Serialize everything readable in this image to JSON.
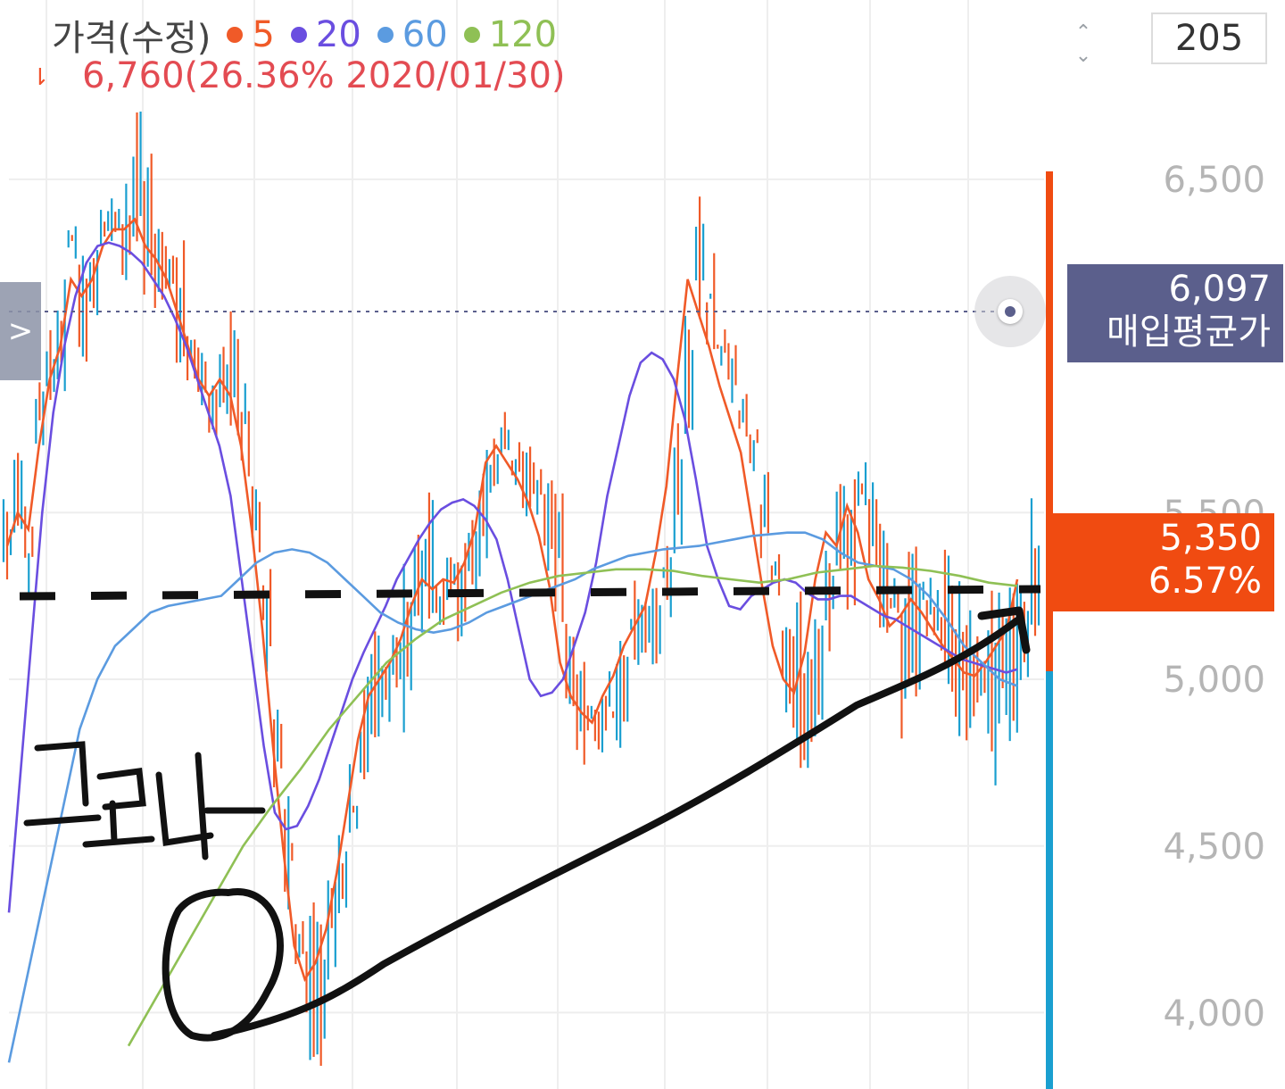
{
  "legend": {
    "title": "가격(수정)",
    "items": [
      {
        "label": "5",
        "color": "#f05a28"
      },
      {
        "label": "20",
        "color": "#6a4ee0"
      },
      {
        "label": "60",
        "color": "#5b9be0"
      },
      {
        "label": "120",
        "color": "#8fc055"
      }
    ]
  },
  "high_info": "6,760(26.36% 2020/01/30)",
  "high_marker": "⇂",
  "stepper": {
    "up": "⌃",
    "down": "⌄"
  },
  "candle_count": "205",
  "side_tab_icon": ">",
  "avg_price": {
    "value": "6,097",
    "label": "매입평균가",
    "color": "#5b5f8c"
  },
  "current_price": {
    "value": "5,350",
    "change": "6.57%",
    "color": "#f04b11"
  },
  "colors": {
    "up": "#f05a28",
    "down": "#1a9fd0",
    "grid": "#eeeeee"
  },
  "chart_data": {
    "type": "line",
    "y_ticks": [
      "6,500",
      "5,500",
      "5,000",
      "4,500",
      "4,000"
    ],
    "y_tick_values": [
      6500,
      5500,
      5000,
      4500,
      4000
    ],
    "ylim": [
      3850,
      6800
    ],
    "grid": true,
    "candles": [
      5400,
      5620,
      5350,
      5800,
      5950,
      6000,
      6300,
      6150,
      6200,
      6350,
      6400,
      6380,
      6450,
      6300,
      6250,
      6200,
      6100,
      6000,
      5900,
      5800,
      5950,
      5900,
      5750,
      5500,
      5200,
      4800,
      4500,
      4200,
      4050,
      4100,
      4250,
      4400,
      4600,
      4800,
      4950,
      5000,
      5050,
      5100,
      5200,
      5300,
      5250,
      5300,
      5280,
      5350,
      5450,
      5650,
      5700,
      5650,
      5600,
      5550,
      5450,
      5300,
      5050,
      4950,
      4900,
      4850,
      4950,
      5000,
      5100,
      5150,
      5200,
      5350,
      5550,
      5900,
      6250,
      6100,
      6000,
      5900,
      5800,
      5700,
      5500,
      5300,
      5100,
      5000,
      4950,
      5050,
      5300,
      5450,
      5400,
      5550,
      5450,
      5300,
      5250,
      5150,
      5200,
      5250,
      5200,
      5150,
      5100,
      5050,
      5000,
      5000,
      5050,
      5100,
      5150,
      5350
    ],
    "series": [
      {
        "name": "5",
        "color": "#f05a28",
        "values": [
          5400,
          5500,
          5450,
          5700,
          5900,
          6000,
          6200,
          6150,
          6200,
          6300,
          6350,
          6350,
          6380,
          6300,
          6260,
          6200,
          6100,
          6000,
          5900,
          5850,
          5900,
          5850,
          5700,
          5450,
          5150,
          4800,
          4480,
          4200,
          4100,
          4150,
          4250,
          4420,
          4620,
          4820,
          4950,
          5000,
          5050,
          5120,
          5220,
          5300,
          5270,
          5300,
          5290,
          5350,
          5450,
          5650,
          5700,
          5650,
          5600,
          5530,
          5430,
          5280,
          5050,
          4950,
          4900,
          4870,
          4950,
          5010,
          5100,
          5160,
          5220,
          5380,
          5580,
          5900,
          6200,
          6100,
          6000,
          5880,
          5780,
          5680,
          5480,
          5280,
          5100,
          5000,
          4960,
          5080,
          5300,
          5440,
          5400,
          5520,
          5440,
          5300,
          5240,
          5160,
          5190,
          5240,
          5200,
          5150,
          5100,
          5060,
          5020,
          5010,
          5050,
          5100,
          5150,
          5300
        ]
      },
      {
        "name": "20",
        "color": "#6a4ee0",
        "values": [
          4300,
          4700,
          5100,
          5500,
          5800,
          6000,
          6150,
          6250,
          6300,
          6310,
          6300,
          6280,
          6250,
          6200,
          6150,
          6080,
          6000,
          5900,
          5800,
          5700,
          5550,
          5300,
          5050,
          4800,
          4600,
          4550,
          4560,
          4620,
          4700,
          4800,
          4900,
          5000,
          5080,
          5150,
          5220,
          5300,
          5360,
          5420,
          5470,
          5510,
          5530,
          5540,
          5520,
          5480,
          5420,
          5300,
          5150,
          5000,
          4950,
          4960,
          5000,
          5100,
          5200,
          5350,
          5550,
          5700,
          5850,
          5950,
          5980,
          5960,
          5900,
          5780,
          5600,
          5400,
          5300,
          5220,
          5210,
          5250,
          5270,
          5290,
          5300,
          5290,
          5260,
          5240,
          5240,
          5250,
          5250,
          5230,
          5210,
          5190,
          5180,
          5160,
          5140,
          5120,
          5100,
          5080,
          5060,
          5050,
          5040,
          5030,
          5020,
          5030
        ]
      },
      {
        "name": "60",
        "color": "#5b9be0",
        "values": [
          3850,
          4100,
          4350,
          4600,
          4850,
          5000,
          5100,
          5150,
          5200,
          5220,
          5230,
          5240,
          5250,
          5300,
          5350,
          5380,
          5390,
          5380,
          5350,
          5300,
          5250,
          5200,
          5170,
          5150,
          5140,
          5150,
          5170,
          5200,
          5220,
          5240,
          5260,
          5280,
          5300,
          5330,
          5350,
          5370,
          5380,
          5390,
          5395,
          5400,
          5410,
          5420,
          5430,
          5435,
          5440,
          5440,
          5420,
          5380,
          5350,
          5340,
          5330,
          5300,
          5250,
          5180,
          5100,
          5050,
          5000,
          4980
        ]
      },
      {
        "name": "120",
        "color": "#8fc055",
        "values": [
          3900,
          4050,
          4200,
          4350,
          4500,
          4620,
          4730,
          4850,
          4950,
          5050,
          5120,
          5180,
          5220,
          5260,
          5290,
          5310,
          5320,
          5330,
          5330,
          5325,
          5310,
          5300,
          5290,
          5300,
          5320,
          5330,
          5340,
          5335,
          5325,
          5310,
          5290,
          5280
        ]
      }
    ]
  }
}
